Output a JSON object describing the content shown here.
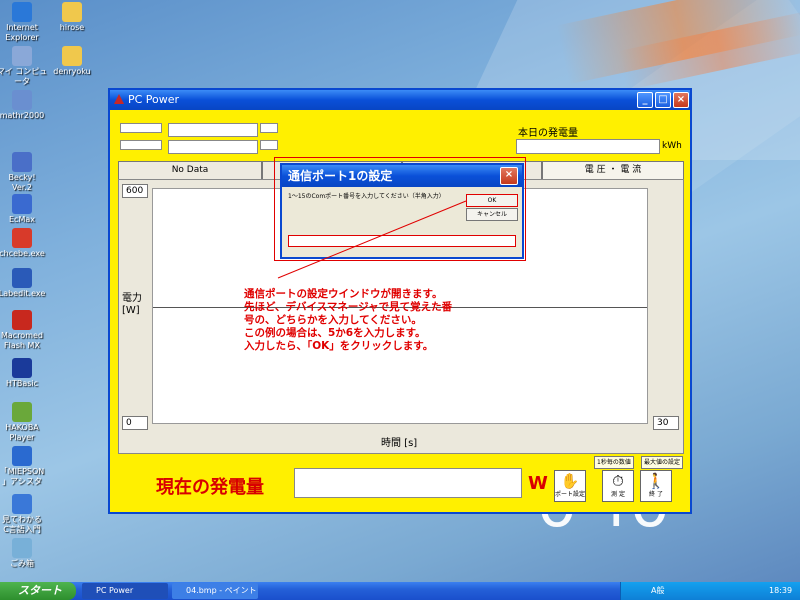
{
  "desktop": {
    "icons": [
      {
        "label": "Internet\nExplorer",
        "color": "#2a78d8"
      },
      {
        "label": "hirose",
        "color": "#f0c84c"
      },
      {
        "label": "マイ コンピュ\nータ",
        "color": "#8aa8d8"
      },
      {
        "label": "denryoku",
        "color": "#f0c84c"
      },
      {
        "label": "mathr2000",
        "color": "#6a8fd0"
      },
      {
        "label": "Becky!\nVer.2",
        "color": "#4a6fc8"
      },
      {
        "label": "EcMax",
        "color": "#3a6ad0"
      },
      {
        "label": "chcebe.exe",
        "color": "#d83a2a"
      },
      {
        "label": "Labedit.exe",
        "color": "#2a5ab8"
      },
      {
        "label": "Macromed\nFlash MX",
        "color": "#c8281e"
      },
      {
        "label": "HTBasic",
        "color": "#1a3a9a"
      },
      {
        "label": "HAKOBA\nPlayer",
        "color": "#6aa83a"
      },
      {
        "label": "「MIEPSON\n」アシスタ",
        "color": "#2a6ad0"
      },
      {
        "label": "見てわかる\nC言語入門",
        "color": "#3a78d8"
      },
      {
        "label": "ごみ箱",
        "color": "#78b0d8"
      }
    ],
    "brand": "o  io"
  },
  "window": {
    "title": "PC Power",
    "today_label": "本日の発電量",
    "kwh_unit": "kWh",
    "tabs": [
      "No Data",
      "",
      "電 圧 ・ 電 流"
    ],
    "y_axis_max": "600",
    "y_axis_min": "0",
    "x_axis_max": "30",
    "y_label": "電力\n[W]",
    "x_label": "時間 [s]",
    "status_left": "1秒毎の数値",
    "status_right": "最大値の設定",
    "current_label": "現在の発電量",
    "current_unit": "W",
    "buttons": [
      "ポート設定",
      "測 定",
      "終 了"
    ]
  },
  "dialog": {
    "title": "通信ポート1の設定",
    "prompt": "1〜15のComポート番号を入力してください（半角入力）",
    "ok": "OK",
    "cancel": "キャンセル",
    "input_value": ""
  },
  "annotation": "通信ポートの設定ウインドウが開きます。\n先ほど、デバイスマネージャで見て覚えた番\n号の、どちらかを入力してください。\nこの例の場合は、5か6を入力します。\n入力したら、「OK」をクリックします。",
  "taskbar": {
    "start": "スタート",
    "tasks": [
      "PC Power",
      "04.bmp - ペイント"
    ],
    "ime": "A般",
    "clock": "18:39"
  },
  "colors": {
    "window_bg": "#fff000",
    "annotation": "#e00000",
    "title_blue": "#0a50d8"
  }
}
